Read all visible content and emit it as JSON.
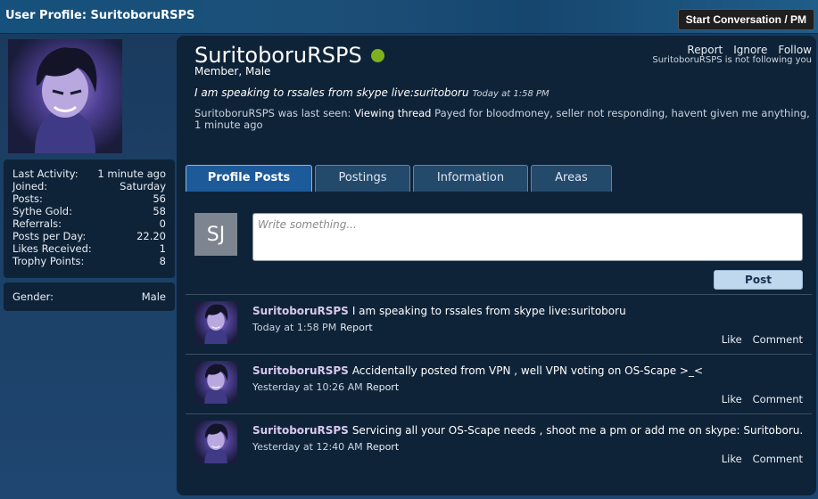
{
  "header": {
    "title": "User Profile: SuritoboruRSPS",
    "start_conversation_label": "Start Conversation / PM"
  },
  "sidebar": {
    "stats": [
      {
        "label": "Last Activity:",
        "value": "1 minute ago"
      },
      {
        "label": "Joined:",
        "value": "Saturday"
      },
      {
        "label": "Posts:",
        "value": "56"
      },
      {
        "label": "Sythe Gold:",
        "value": "58"
      },
      {
        "label": "Referrals:",
        "value": "0"
      },
      {
        "label": "Posts per Day:",
        "value": "22.20"
      },
      {
        "label": "Likes Received:",
        "value": "1"
      },
      {
        "label": "Trophy Points:",
        "value": "8"
      }
    ],
    "gender": {
      "label": "Gender:",
      "value": "Male"
    }
  },
  "profile": {
    "username": "SuritoboruRSPS",
    "user_title": "Member, Male",
    "online_status_color": "#7fb11f",
    "links": {
      "report": "Report",
      "ignore": "Ignore",
      "follow": "Follow"
    },
    "follow_note": "SuritoboruRSPS is not following you",
    "status": {
      "text": "I am speaking to rssales from skype live:suritoboru",
      "time": "Today at 1:58 PM"
    },
    "last_seen": {
      "prefix": "SuritoboruRSPS was last seen:",
      "action": "Viewing thread",
      "thread": "Payed for bloodmoney, seller not responding, havent given me anything,",
      "when": "1 minute ago"
    }
  },
  "tabs": [
    {
      "label": "Profile Posts",
      "active": true
    },
    {
      "label": "Postings",
      "active": false
    },
    {
      "label": "Information",
      "active": false
    },
    {
      "label": "Areas",
      "active": false
    }
  ],
  "composer": {
    "avatar_initials": "SJ",
    "placeholder": "Write something...",
    "post_label": "Post"
  },
  "posts": [
    {
      "author": "SuritoboruRSPS",
      "text": "I am speaking to rssales from skype live:suritoboru",
      "time": "Today at 1:58 PM",
      "report": "Report",
      "like": "Like",
      "comment": "Comment"
    },
    {
      "author": "SuritoboruRSPS",
      "text": "Accidentally posted from VPN , well VPN voting on OS-Scape >_<",
      "time": "Yesterday at 10:26 AM",
      "report": "Report",
      "like": "Like",
      "comment": "Comment"
    },
    {
      "author": "SuritoboruRSPS",
      "text": "Servicing all your OS-Scape needs , shoot me a pm or add me on skype: Suritoboru.",
      "time": "Yesterday at 12:40 AM",
      "report": "Report",
      "like": "Like",
      "comment": "Comment"
    }
  ],
  "colors": {
    "header_bar": "#15517c",
    "card_background": "#0f2338",
    "active_tab": "#1d5a99",
    "post_button": "#bfd8ee"
  }
}
